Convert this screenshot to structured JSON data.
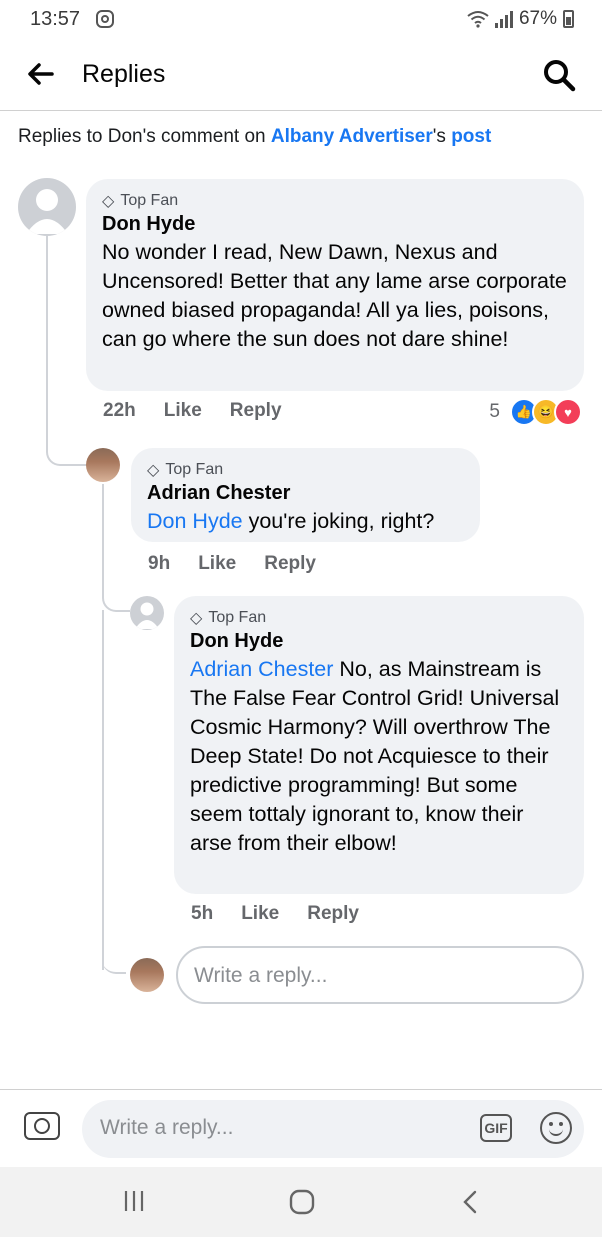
{
  "status": {
    "time": "13:57",
    "battery": "67%"
  },
  "header": {
    "title": "Replies",
    "back_icon": "arrow-left-icon",
    "search_icon": "search-icon"
  },
  "subtitle": {
    "prefix": "Replies to Don's comment on ",
    "page_name": "Albany Advertiser",
    "possessive": "'s ",
    "post_link": "post"
  },
  "comments": [
    {
      "badge": "Top Fan",
      "author": "Don Hyde",
      "mention": "",
      "text": "No wonder I read, New Dawn, Nexus and Uncensored! Better that any lame arse corporate owned biased propaganda! All ya lies, poisons, can go where the sun does not dare shine!",
      "time": "22h",
      "like": "Like",
      "reply": "Reply",
      "reaction_count": "5"
    },
    {
      "badge": "Top Fan",
      "author": "Adrian Chester",
      "mention": "Don Hyde",
      "text": " you're joking,  right?",
      "time": "9h",
      "like": "Like",
      "reply": "Reply"
    },
    {
      "badge": "Top Fan",
      "author": "Don Hyde",
      "mention": "Adrian Chester",
      "text": " No, as Mainstream is The False Fear Control Grid! Universal Cosmic Harmony? Will overthrow The Deep State! Do not Acquiesce to their predictive programming! But some seem tottaly ignorant to, know their arse from their elbow!",
      "time": "5h",
      "like": "Like",
      "reply": "Reply"
    }
  ],
  "inline_reply_placeholder": "Write a reply...",
  "composer": {
    "placeholder": "Write a reply...",
    "gif_label": "GIF"
  },
  "colors": {
    "link": "#1877f2",
    "bubble": "#f0f2f5",
    "meta": "#65676b"
  }
}
